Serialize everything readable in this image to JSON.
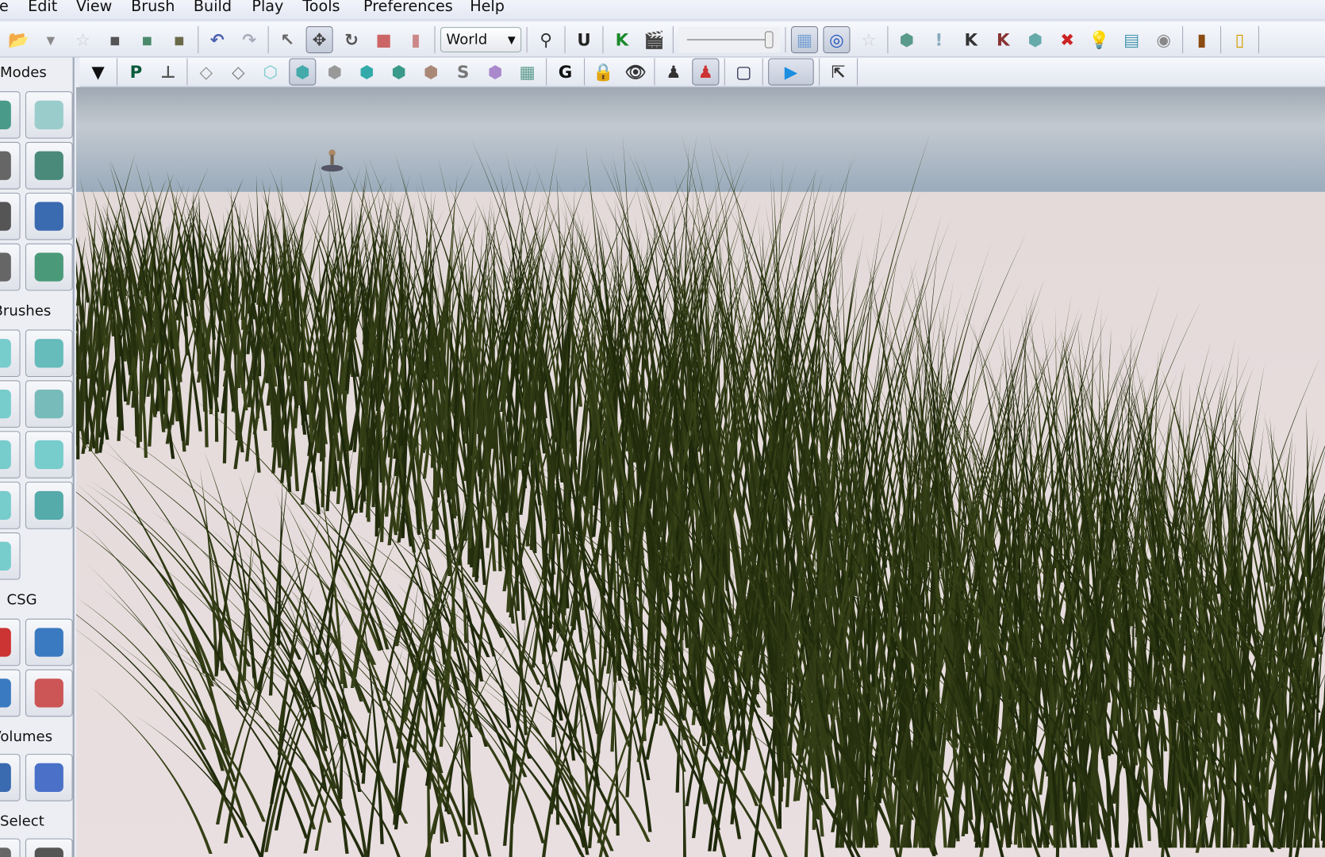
{
  "menu": [
    "File",
    "Edit",
    "View",
    "Brush",
    "Build",
    "Play",
    "Tools",
    "Preferences",
    "Help"
  ],
  "toolbar1": {
    "groups": [
      [
        {
          "name": "open-icon",
          "g": "📂",
          "c": "#d8b84a"
        },
        {
          "name": "dropdown-arrow-icon",
          "g": "▾",
          "c": "#888"
        },
        {
          "name": "favorite-star-icon",
          "g": "☆",
          "c": "#ccc"
        },
        {
          "name": "save-icon",
          "g": "▪",
          "c": "#555"
        },
        {
          "name": "save-all-icon",
          "g": "▪",
          "c": "#4a8a6a"
        },
        {
          "name": "save-copy-icon",
          "g": "▪",
          "c": "#6a6a4a"
        }
      ],
      [
        {
          "name": "undo-icon",
          "g": "↶",
          "c": "#4a5fb0"
        },
        {
          "name": "redo-icon",
          "g": "↷",
          "c": "#aab"
        }
      ],
      [
        {
          "name": "select-icon",
          "g": "↖",
          "c": "#666"
        },
        {
          "name": "translate-icon",
          "g": "✥",
          "c": "#444",
          "active": true
        },
        {
          "name": "rotate-icon",
          "g": "↻",
          "c": "#555"
        },
        {
          "name": "scale-icon",
          "g": "■",
          "c": "#c66"
        },
        {
          "name": "scale-nonuniform-icon",
          "g": "▮",
          "c": "#c88"
        }
      ],
      [
        {
          "type": "world"
        }
      ],
      [
        {
          "name": "binoculars-icon",
          "g": "⚲",
          "c": "#333"
        }
      ],
      [
        {
          "name": "unreal-content-browser-icon",
          "g": "U",
          "c": "#222"
        }
      ],
      [
        {
          "name": "kismet-icon",
          "g": "K",
          "c": "#1a8a2a"
        },
        {
          "name": "matinee-icon",
          "g": "🎬",
          "c": "#222"
        }
      ],
      [
        {
          "type": "slider"
        }
      ],
      [
        {
          "name": "realtime-view-icon",
          "g": "▦",
          "c": "#7aa4d4",
          "active": true
        },
        {
          "name": "grid-snap-icon",
          "g": "◎",
          "c": "#2255c0",
          "active": true
        },
        {
          "name": "bookmark-star-icon",
          "g": "☆",
          "c": "#ccc"
        }
      ],
      [
        {
          "name": "build-geometry-icon",
          "g": "⬢",
          "c": "#5a9a8a"
        },
        {
          "name": "build-lighting-icon",
          "g": "!",
          "c": "#8ab"
        },
        {
          "name": "build-paths-icon",
          "g": "K",
          "c": "#333"
        },
        {
          "name": "build-cover-icon",
          "g": "K",
          "c": "#833"
        },
        {
          "name": "build-all-icon",
          "g": "⬢",
          "c": "#6aa"
        },
        {
          "name": "cancel-build-icon",
          "g": "✖",
          "c": "#c22"
        },
        {
          "name": "lighting-quality-icon",
          "g": "💡",
          "c": "#888"
        },
        {
          "name": "lighting-info-icon",
          "g": "▤",
          "c": "#4a9ab0"
        },
        {
          "name": "sound-icon",
          "g": "◉",
          "c": "#888"
        }
      ],
      [
        {
          "name": "play-on-console-icon",
          "g": "▮",
          "c": "#8a4a10"
        }
      ],
      [
        {
          "name": "mobile-preview-icon",
          "g": "▯",
          "c": "#d4a000"
        }
      ]
    ],
    "world_label": "World",
    "slider_value": 0.92
  },
  "toolbar2": {
    "modes_label": "Modes",
    "groups": [
      [
        {
          "name": "modes-dropdown-icon",
          "g": "▼",
          "c": "#111",
          "plain": true
        }
      ],
      [
        {
          "name": "prefabs-icon",
          "g": "P",
          "c": "#0a5a3a",
          "plain": true
        },
        {
          "name": "actor-icon",
          "g": "⊥",
          "c": "#555",
          "plain": true
        }
      ],
      [
        {
          "name": "wireframe-icon",
          "g": "◇",
          "c": "#888"
        },
        {
          "name": "brush-wireframe-icon",
          "g": "◇",
          "c": "#777"
        },
        {
          "name": "unlit-icon",
          "g": "⬡",
          "c": "#7cc"
        },
        {
          "name": "lit-icon",
          "g": "⬢",
          "c": "#4aa",
          "active": true
        },
        {
          "name": "detail-lighting-icon",
          "g": "⬢",
          "c": "#999"
        },
        {
          "name": "lighting-only-icon",
          "g": "⬢",
          "c": "#3aa"
        },
        {
          "name": "light-complexity-icon",
          "g": "⬢",
          "c": "#3a9a8a"
        },
        {
          "name": "texture-density-icon",
          "g": "⬢",
          "c": "#a87"
        },
        {
          "name": "shader-complexity-icon",
          "g": "S",
          "c": "#777"
        },
        {
          "name": "lightmap-density-icon",
          "g": "⬢",
          "c": "#a8c"
        },
        {
          "name": "reflections-icon",
          "g": "▦",
          "c": "#5a9a8a"
        }
      ],
      [
        {
          "name": "game-view-icon",
          "g": "G",
          "c": "#111",
          "plain": true
        }
      ],
      [
        {
          "name": "lock-icon",
          "g": "🔒",
          "c": "#e0a020"
        },
        {
          "name": "eye-icon",
          "g": "👁",
          "c": "#333"
        }
      ],
      [
        {
          "name": "camera-actor-icon",
          "g": "♟",
          "c": "#333"
        },
        {
          "name": "player-start-icon",
          "g": "♟",
          "c": "#c33",
          "active": true
        }
      ],
      [
        {
          "name": "viewport-frame-icon",
          "g": "▢",
          "c": "#224"
        }
      ],
      [
        {
          "name": "play-in-viewport-icon",
          "g": "▶",
          "c": "#1a8ee0",
          "active": true,
          "wide": true
        }
      ],
      [
        {
          "name": "maximize-viewport-icon",
          "g": "⇱",
          "c": "#333"
        }
      ]
    ]
  },
  "panel": {
    "sections": [
      {
        "label": "Modes",
        "rows": [
          [
            "camera-mode-icon",
            "#4a9a8a",
            "geometry-mode-icon",
            "#9acccc"
          ],
          [
            "texture-align-icon",
            "#666",
            "transform-gizmo-icon",
            "#4a8a7a"
          ],
          [
            "terrain-icon",
            "#555",
            "mesh-paint-icon",
            "#3a6ab0"
          ],
          [
            "landscape-icon",
            "#666",
            "foliage-icon",
            "#4a9a7a"
          ]
        ]
      },
      {
        "label": "Brushes",
        "rows": [
          [
            "cube-brush-icon",
            "#7cc",
            "cone-brush-icon",
            "#6bb"
          ],
          [
            "curved-stair-icon",
            "#7cc",
            "cylinder-brush-icon",
            "#7bb"
          ],
          [
            "linear-stair-icon",
            "#7cc",
            "sheet-brush-icon",
            "#7cc"
          ],
          [
            "spiral-stair-icon",
            "#7cc",
            "sphere-brush-icon",
            "#5aa"
          ],
          [
            "volumetric-brush-icon",
            "#7cc",
            null,
            null
          ]
        ]
      },
      {
        "label": "CSG",
        "rows": [
          [
            "csg-add-icon",
            "#c33",
            "csg-subtract-icon",
            "#3a7ac0"
          ],
          [
            "csg-intersect-icon",
            "#3a7ac0",
            "csg-deintersect-icon",
            "#c55"
          ]
        ]
      },
      {
        "label": "Volumes",
        "rows": [
          [
            "volume-list-icon",
            "#3a6ab0",
            "add-volume-icon",
            "#4a70c8"
          ]
        ]
      },
      {
        "label": "Select",
        "rows": [
          [
            "select-1-icon",
            "#666",
            "select-2-icon",
            "#555"
          ]
        ]
      }
    ]
  }
}
